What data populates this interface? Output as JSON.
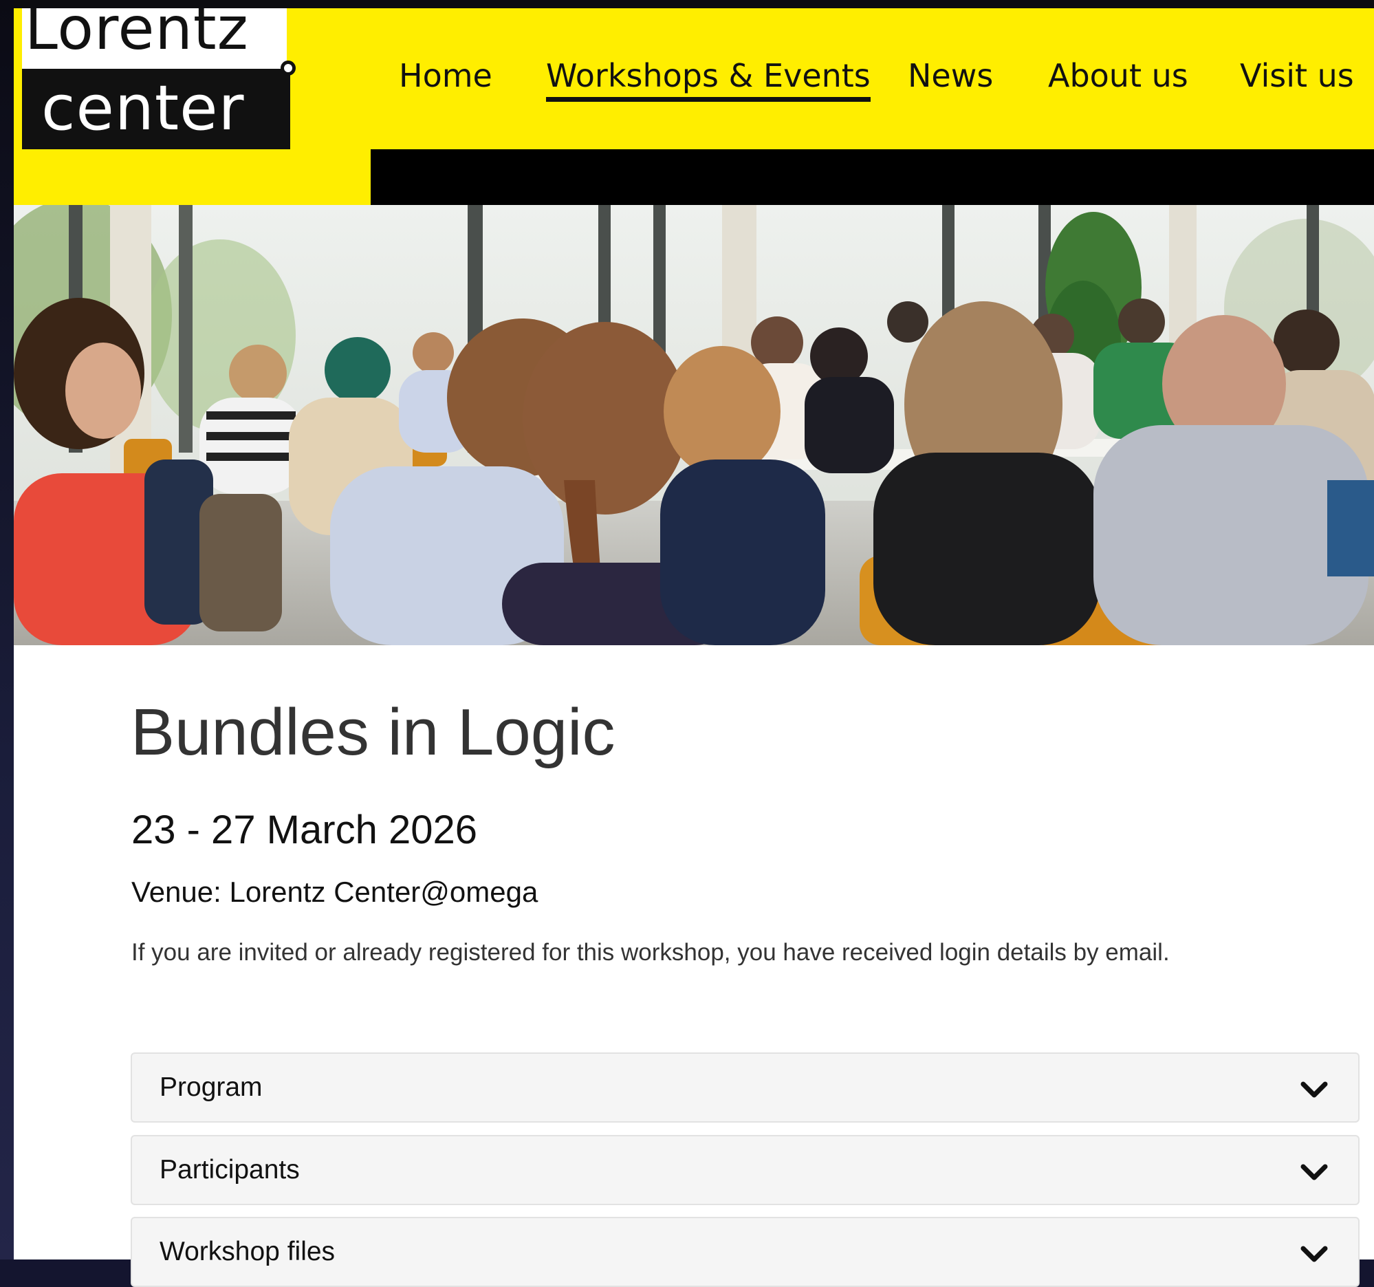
{
  "logo": {
    "line1": "Lorentz",
    "line2": "center"
  },
  "nav": {
    "items": [
      {
        "label": "Home",
        "active": false
      },
      {
        "label": "Workshops & Events",
        "active": true
      },
      {
        "label": "News",
        "active": false
      },
      {
        "label": "About us",
        "active": false
      },
      {
        "label": "Visit us",
        "active": false
      }
    ]
  },
  "colors": {
    "brand_yellow": "#ffee00",
    "header_black": "#000000",
    "title_gray": "#333333"
  },
  "event": {
    "title": "Bundles in Logic",
    "dates": "23 - 27 March 2026",
    "venue": "Venue: Lorentz Center@omega",
    "info": "If you are invited or already registered for this workshop, you have received login details by email."
  },
  "sections": [
    {
      "label": "Program",
      "icon": "chevron-down-icon"
    },
    {
      "label": "Participants",
      "icon": "chevron-down-icon"
    },
    {
      "label": "Workshop files",
      "icon": "chevron-down-icon"
    }
  ]
}
